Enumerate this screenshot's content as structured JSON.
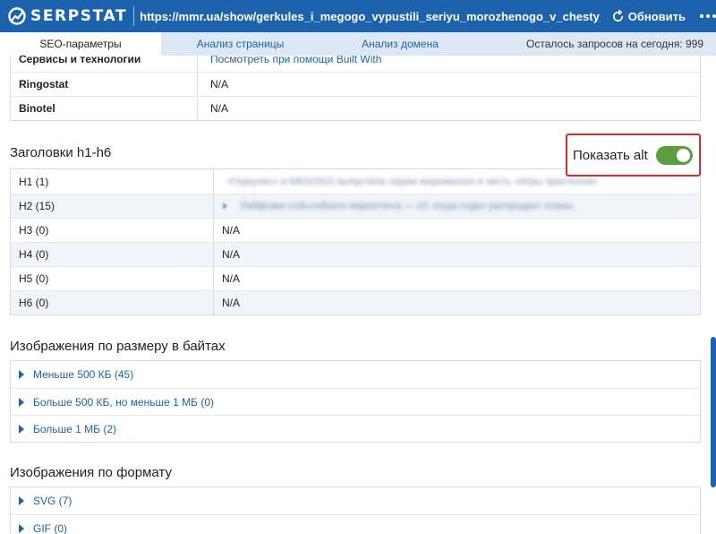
{
  "header": {
    "logo_text": "SERPSTAT",
    "url": "https://mmr.ua/show/gerkules_i_megogo_vypustili_seriyu_morozhenogo_v_chesty_igry_prestolov",
    "refresh_label": "Обновить"
  },
  "tabs": [
    {
      "label": "SEO-параметры"
    },
    {
      "label": "Анализ страницы"
    },
    {
      "label": "Анализ домена"
    }
  ],
  "remaining_label": "Осталось запросов на сегодня: 999",
  "tech_table": [
    {
      "name": "Сервисы и технологии",
      "value": "Посмотреть при помощи Built With"
    },
    {
      "name": "Ringostat",
      "value": "N/A"
    },
    {
      "name": "Binotel",
      "value": "N/A"
    }
  ],
  "headings": {
    "title": "Заголовки h1-h6",
    "toggle_label": "Показать alt",
    "toggle_on": true,
    "toggle_color": "#5a9e3e",
    "rows": [
      {
        "tag": "H1 (1)",
        "value": "«Геркулес» и MEGOGO выпустили серию мороженого в честь «Игры престолов»"
      },
      {
        "tag": "H2 (15)",
        "value": "Лайфхаки событийного маркетинга — 10: когда отдел распродает планы"
      },
      {
        "tag": "H3 (0)",
        "value": "N/A"
      },
      {
        "tag": "H4 (0)",
        "value": "N/A"
      },
      {
        "tag": "H5 (0)",
        "value": "N/A"
      },
      {
        "tag": "H6 (0)",
        "value": "N/A"
      }
    ]
  },
  "images_by_size": {
    "title": "Изображения по размеру в байтах",
    "items": [
      {
        "label": "Меньше 500 КБ (45)"
      },
      {
        "label": "Больше 500 КБ, но меньше 1 МБ (0)"
      },
      {
        "label": "Больше 1 МБ (2)"
      }
    ]
  },
  "images_by_format": {
    "title": "Изображения по формату",
    "items": [
      {
        "label": "SVG (7)"
      },
      {
        "label": "GIF (0)"
      }
    ]
  },
  "colors": {
    "brand": "#1d62ad",
    "tab_bar": "#dce8f5",
    "highlight": "#d32f2f"
  }
}
